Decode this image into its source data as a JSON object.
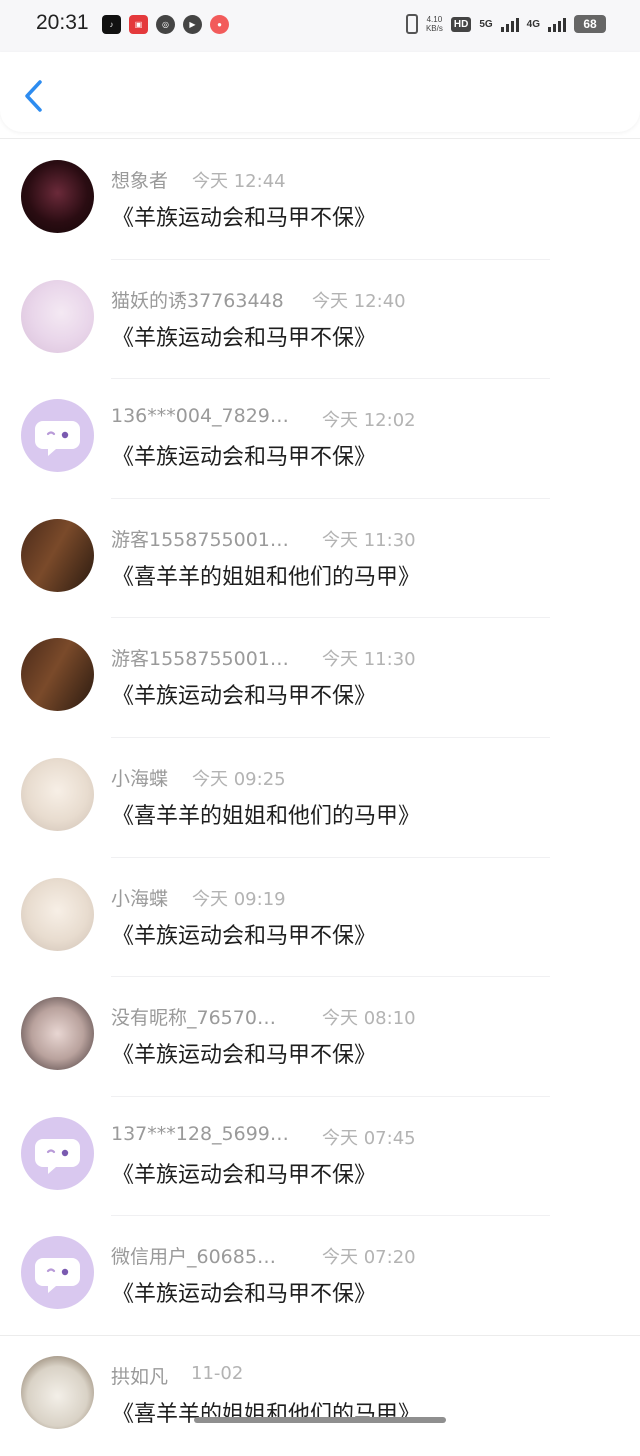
{
  "status_bar": {
    "time": "20:31",
    "speed_value": "4.10",
    "speed_unit": "KB/s",
    "hd_label": "HD",
    "net1": "5G",
    "net2": "4G",
    "battery": "68",
    "app_icons": [
      "tiktok-icon",
      "xiaohongshu-icon",
      "swirl-app-icon",
      "play-app-icon",
      "redbook-app-icon"
    ]
  },
  "header": {
    "back_icon": "chevron-left-icon",
    "accent": "#2d8cf0"
  },
  "messages": [
    {
      "name": "想象者",
      "time": "今天 12:44",
      "title": "《羊族运动会和马甲不保》",
      "avatar": "dark"
    },
    {
      "name": "猫妖的诱37763448",
      "time": "今天 12:40",
      "title": "《羊族运动会和马甲不保》",
      "avatar": "pink"
    },
    {
      "name": "136***004_7829…",
      "time": "今天 12:02",
      "title": "《羊族运动会和马甲不保》",
      "avatar": "default"
    },
    {
      "name": "游客1558755001…",
      "time": "今天 11:30",
      "title": "《喜羊羊的姐姐和他们的马甲》",
      "avatar": "box"
    },
    {
      "name": "游客1558755001…",
      "time": "今天 11:30",
      "title": "《羊族运动会和马甲不保》",
      "avatar": "box"
    },
    {
      "name": "小海蝶",
      "time": "今天 09:25",
      "title": "《喜羊羊的姐姐和他们的马甲》",
      "avatar": "doll"
    },
    {
      "name": "小海蝶",
      "time": "今天 09:19",
      "title": "《羊族运动会和马甲不保》",
      "avatar": "doll"
    },
    {
      "name": "没有昵称_76570…",
      "time": "今天 08:10",
      "title": "《羊族运动会和马甲不保》",
      "avatar": "girl"
    },
    {
      "name": "137***128_5699…",
      "time": "今天 07:45",
      "title": "《羊族运动会和马甲不保》",
      "avatar": "default"
    },
    {
      "name": "微信用户_60685…",
      "time": "今天 07:20",
      "title": "《羊族运动会和马甲不保》",
      "avatar": "default"
    },
    {
      "name": "拱如凡",
      "time": "11-02",
      "title": "《喜羊羊的姐姐和他们的马甲》",
      "avatar": "dog"
    }
  ]
}
